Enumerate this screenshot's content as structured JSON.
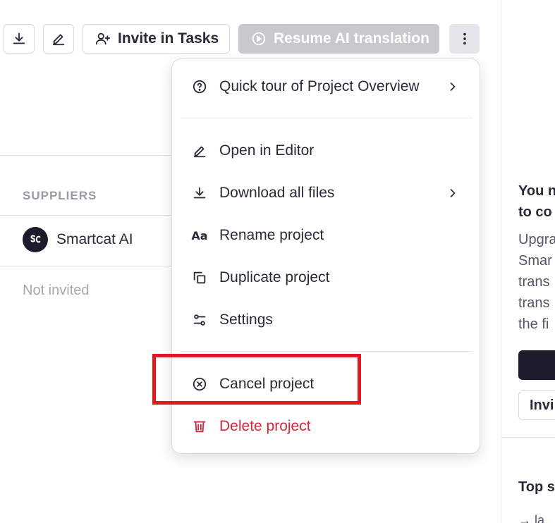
{
  "toolbar": {
    "download_icon": "download-icon",
    "edit_icon": "pencil-icon",
    "invite_label": "Invite in Tasks",
    "resume_label": "Resume AI translation",
    "more_icon": "kebab-menu-icon"
  },
  "suppliers": {
    "heading": "SUPPLIERS",
    "items": [
      {
        "name": "Smartcat AI",
        "status": "Not invited"
      }
    ]
  },
  "menu": {
    "items": [
      {
        "label": "Quick tour of Project Overview",
        "icon": "question-circle-icon",
        "submenu": true
      },
      {
        "label": "Open in Editor",
        "icon": "pencil-icon",
        "submenu": false
      },
      {
        "label": "Download all files",
        "icon": "download-icon",
        "submenu": true
      },
      {
        "label": "Rename project",
        "icon": "text-aa-icon",
        "submenu": false
      },
      {
        "label": "Duplicate project",
        "icon": "duplicate-icon",
        "submenu": false
      },
      {
        "label": "Settings",
        "icon": "sliders-icon",
        "submenu": false
      },
      {
        "label": "Cancel project",
        "icon": "x-circle-icon",
        "submenu": false
      },
      {
        "label": "Delete project",
        "icon": "trash-icon",
        "submenu": false,
        "danger": true
      }
    ],
    "danger_color": "#d9243c"
  },
  "right_panel": {
    "title_lines": [
      "You n",
      "to co"
    ],
    "body_lines": [
      "Upgra",
      "Smar",
      "trans",
      "trans",
      "the fi"
    ],
    "secondary_button": "Invi",
    "section_title": "Top s",
    "link_text": "→ la"
  },
  "highlight": {
    "target": "Cancel project",
    "color": "#e0191e"
  }
}
